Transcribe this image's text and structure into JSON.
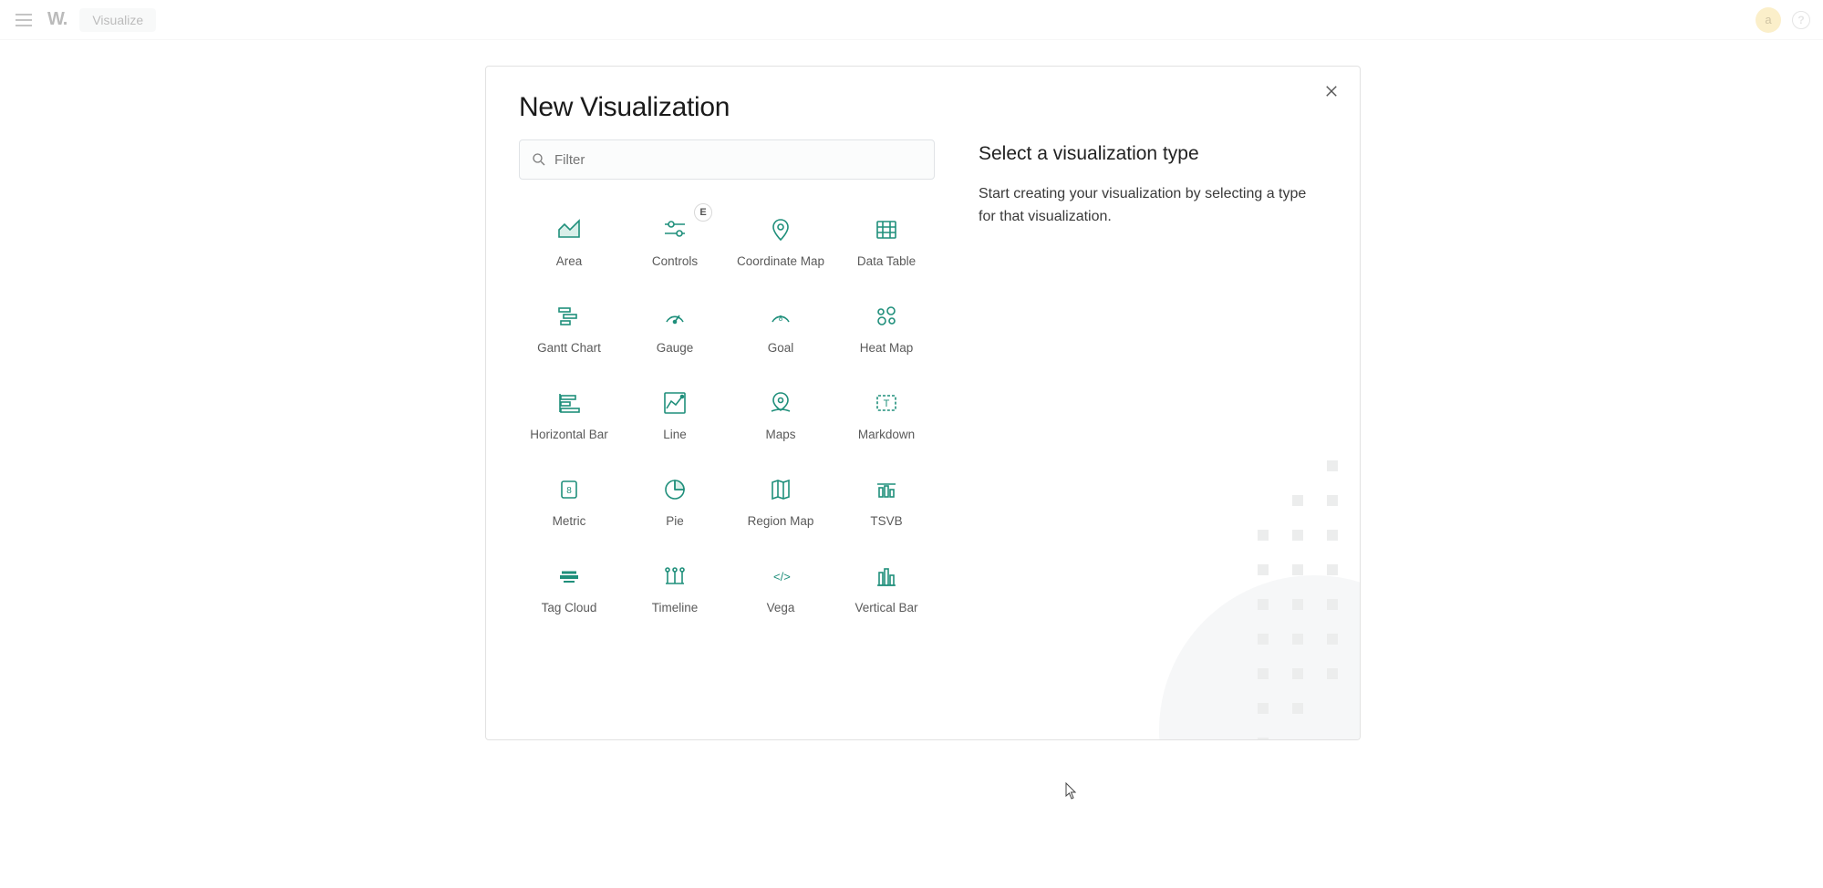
{
  "topbar": {
    "logo_text": "W.",
    "breadcrumb": "Visualize",
    "avatar_letter": "a",
    "help_char": "?"
  },
  "modal": {
    "title": "New Visualization",
    "filter_placeholder": "Filter",
    "right": {
      "title": "Select a visualization type",
      "text": "Start creating your visualization by selecting a type for that visualization."
    },
    "viz_types": [
      {
        "key": "area",
        "label": "Area",
        "icon": "area"
      },
      {
        "key": "controls",
        "label": "Controls",
        "icon": "controls",
        "badge": "E"
      },
      {
        "key": "coordinate-map",
        "label": "Coordinate Map",
        "icon": "pin"
      },
      {
        "key": "data-table",
        "label": "Data Table",
        "icon": "table"
      },
      {
        "key": "gantt-chart",
        "label": "Gantt Chart",
        "icon": "gantt"
      },
      {
        "key": "gauge",
        "label": "Gauge",
        "icon": "gauge"
      },
      {
        "key": "goal",
        "label": "Goal",
        "icon": "goal"
      },
      {
        "key": "heat-map",
        "label": "Heat Map",
        "icon": "heat"
      },
      {
        "key": "horizontal-bar",
        "label": "Horizontal Bar",
        "icon": "hbar"
      },
      {
        "key": "line",
        "label": "Line",
        "icon": "line"
      },
      {
        "key": "maps",
        "label": "Maps",
        "icon": "maps"
      },
      {
        "key": "markdown",
        "label": "Markdown",
        "icon": "markdown"
      },
      {
        "key": "metric",
        "label": "Metric",
        "icon": "metric"
      },
      {
        "key": "pie",
        "label": "Pie",
        "icon": "pie"
      },
      {
        "key": "region-map",
        "label": "Region Map",
        "icon": "region"
      },
      {
        "key": "tsvb",
        "label": "TSVB",
        "icon": "tsvb"
      },
      {
        "key": "tag-cloud",
        "label": "Tag Cloud",
        "icon": "tagcloud"
      },
      {
        "key": "timeline",
        "label": "Timeline",
        "icon": "timeline"
      },
      {
        "key": "vega",
        "label": "Vega",
        "icon": "vega"
      },
      {
        "key": "vertical-bar",
        "label": "Vertical Bar",
        "icon": "vbar"
      }
    ]
  },
  "colors": {
    "accent": "#1f8f7b"
  }
}
